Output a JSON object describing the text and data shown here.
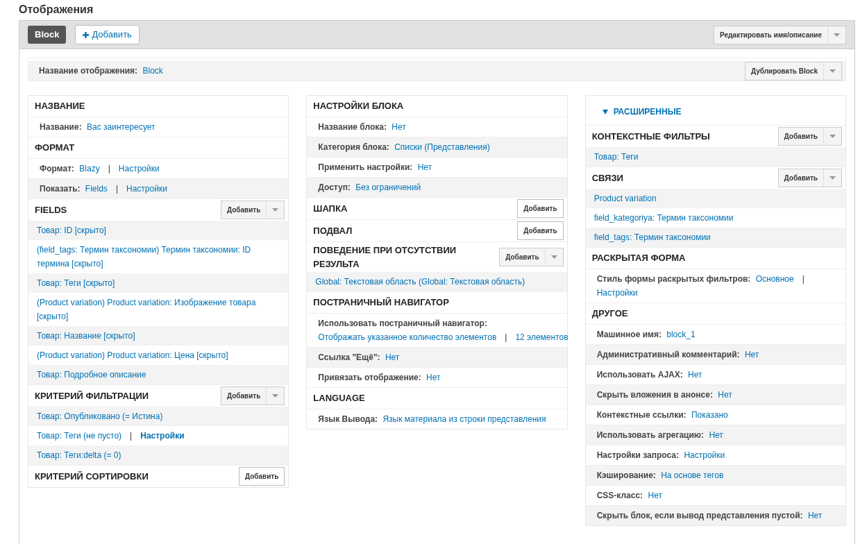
{
  "page_title": "Отображения",
  "displays": [
    {
      "label": "Block",
      "selected": true
    }
  ],
  "add_display": {
    "label": "Добавить"
  },
  "edit_button": {
    "label": "Редактировать имя/описание"
  },
  "display_name": {
    "label": "Название отображения:",
    "value": "Block"
  },
  "duplicate_button": {
    "label": "Дублировать Block"
  },
  "columns": [
    [
      {
        "title": "НАЗВАНИЕ",
        "rows": [
          {
            "kind": "setting",
            "label": "Название:",
            "parts": [
              {
                "kind": "link",
                "text": "Вас заинтересует"
              }
            ]
          }
        ]
      },
      {
        "title": "ФОРМАТ",
        "rows": [
          {
            "kind": "setting",
            "label": "Формат:",
            "parts": [
              {
                "kind": "link",
                "text": "Blazy"
              },
              {
                "kind": "separator",
                "text": "|"
              },
              {
                "kind": "link",
                "text": "Настройки"
              }
            ]
          },
          {
            "kind": "setting",
            "label": "Показать:",
            "parts": [
              {
                "kind": "link",
                "text": "Fields"
              },
              {
                "kind": "separator",
                "text": "|"
              },
              {
                "kind": "link",
                "text": "Настройки"
              }
            ]
          }
        ]
      },
      {
        "title": "FIELDS",
        "button": {
          "kind": "split",
          "label": "Добавить"
        },
        "rows": [
          {
            "kind": "item",
            "parts": [
              {
                "kind": "link",
                "text": "Товар: ID [скрыто]"
              }
            ]
          },
          {
            "kind": "item",
            "parts": [
              {
                "kind": "link",
                "text": "(field_tags: Термин таксономии) Термин таксономии: ID термина [скрыто]"
              }
            ]
          },
          {
            "kind": "item",
            "parts": [
              {
                "kind": "link",
                "text": "Товар: Теги [скрыто]"
              }
            ]
          },
          {
            "kind": "item",
            "parts": [
              {
                "kind": "link",
                "text": "(Product variation) Product variation: Изображение товара [скрыто]"
              }
            ]
          },
          {
            "kind": "item",
            "parts": [
              {
                "kind": "link",
                "text": "Товар: Название [скрыто]"
              }
            ]
          },
          {
            "kind": "item",
            "parts": [
              {
                "kind": "link",
                "text": "(Product variation) Product variation: Цена [скрыто]"
              }
            ]
          },
          {
            "kind": "item",
            "parts": [
              {
                "kind": "link",
                "text": "Товар: Подробное описание"
              }
            ]
          }
        ]
      },
      {
        "title": "КРИТЕРИЙ ФИЛЬТРАЦИИ",
        "button": {
          "kind": "split",
          "label": "Добавить"
        },
        "rows": [
          {
            "kind": "item",
            "parts": [
              {
                "kind": "link",
                "text": "Товар: Опубликовано (= Истина)"
              }
            ]
          },
          {
            "kind": "item",
            "parts": [
              {
                "kind": "link",
                "text": "Товар: Теги (не пусто)"
              },
              {
                "kind": "separator",
                "text": "|"
              },
              {
                "kind": "strong-link",
                "text": "Настройки"
              }
            ]
          },
          {
            "kind": "item",
            "parts": [
              {
                "kind": "link",
                "text": "Товар: Теги:delta (= 0)"
              }
            ]
          }
        ]
      },
      {
        "title": "КРИТЕРИЙ СОРТИРОВКИ",
        "button": {
          "kind": "plain",
          "label": "Добавить"
        }
      }
    ],
    [
      {
        "title": "НАСТРОЙКИ БЛОКА",
        "rows": [
          {
            "kind": "setting",
            "label": "Название блока:",
            "parts": [
              {
                "kind": "link",
                "text": "Нет"
              }
            ]
          },
          {
            "kind": "setting",
            "label": "Категория блока:",
            "parts": [
              {
                "kind": "link",
                "text": "Списки (Представления)"
              }
            ]
          },
          {
            "kind": "setting",
            "label": "Применить настройки:",
            "parts": [
              {
                "kind": "link",
                "text": "Нет"
              }
            ]
          },
          {
            "kind": "setting",
            "label": "Доступ:",
            "parts": [
              {
                "kind": "link",
                "text": "Без ограничений"
              }
            ]
          }
        ]
      },
      {
        "title": "ШАПКА",
        "button": {
          "kind": "plain",
          "label": "Добавить"
        }
      },
      {
        "title": "ПОДВАЛ",
        "button": {
          "kind": "plain",
          "label": "Добавить"
        }
      },
      {
        "title": "ПОВЕДЕНИЕ ПРИ ОТСУТСТВИИ РЕЗУЛЬТА",
        "button": {
          "kind": "split",
          "label": "Добавить"
        },
        "rows": [
          {
            "kind": "item",
            "parts": [
              {
                "kind": "link",
                "text": "Global: Текстовая область (Global: Текстовая область)"
              }
            ]
          }
        ]
      },
      {
        "title": "ПОСТРАНИЧНЫЙ НАВИГАТОР",
        "rows": [
          {
            "kind": "setting",
            "label": "Использовать постраничный навигатор:",
            "parts": [
              {
                "kind": "link",
                "text": "Отображать указанное количество элементов"
              },
              {
                "kind": "separator",
                "text": "|"
              },
              {
                "kind": "link",
                "text": "12 элементов"
              }
            ]
          },
          {
            "kind": "setting",
            "label": "Ссылка \"Ещё\":",
            "parts": [
              {
                "kind": "link",
                "text": "Нет"
              }
            ]
          },
          {
            "kind": "setting",
            "label": "Привязать отображение:",
            "parts": [
              {
                "kind": "link",
                "text": "Нет"
              }
            ]
          }
        ]
      },
      {
        "title": "LANGUAGE",
        "rows": [
          {
            "kind": "setting",
            "label": "Язык Вывода:",
            "parts": [
              {
                "kind": "link",
                "text": "Язык материала из строки представления"
              }
            ]
          }
        ]
      }
    ],
    [
      {
        "title": "КОНТЕКСТНЫЕ ФИЛЬТРЫ",
        "button": {
          "kind": "split",
          "label": "Добавить"
        },
        "rows": [
          {
            "kind": "item",
            "parts": [
              {
                "kind": "link",
                "text": "Товар: Теги"
              }
            ]
          }
        ]
      },
      {
        "title": "СВЯЗИ",
        "button": {
          "kind": "split",
          "label": "Добавить"
        },
        "rows": [
          {
            "kind": "item",
            "parts": [
              {
                "kind": "link",
                "text": "Product variation"
              }
            ]
          },
          {
            "kind": "item",
            "parts": [
              {
                "kind": "link",
                "text": "field_kategoriya: Термин таксономии"
              }
            ]
          },
          {
            "kind": "item",
            "parts": [
              {
                "kind": "link",
                "text": "field_tags: Термин таксономии"
              }
            ]
          }
        ]
      },
      {
        "title": "РАСКРЫТАЯ ФОРМА",
        "rows": [
          {
            "kind": "setting",
            "label": "Стиль формы раскрытых фильтров:",
            "parts": [
              {
                "kind": "link",
                "text": "Основное"
              },
              {
                "kind": "separator",
                "text": "|"
              },
              {
                "kind": "link",
                "text": "Настройки"
              }
            ]
          }
        ]
      },
      {
        "title": "ДРУГОЕ",
        "rows": [
          {
            "kind": "setting",
            "label": "Машинное имя:",
            "parts": [
              {
                "kind": "link",
                "text": "block_1"
              }
            ]
          },
          {
            "kind": "setting",
            "label": "Административный комментарий:",
            "parts": [
              {
                "kind": "link",
                "text": "Нет"
              }
            ]
          },
          {
            "kind": "setting",
            "label": "Использовать AJAX:",
            "parts": [
              {
                "kind": "link",
                "text": "Нет"
              }
            ]
          },
          {
            "kind": "setting",
            "label": "Скрыть вложения в анонсе:",
            "parts": [
              {
                "kind": "link",
                "text": "Нет"
              }
            ]
          },
          {
            "kind": "setting",
            "label": "Контекстные ссылки:",
            "parts": [
              {
                "kind": "link",
                "text": "Показано"
              }
            ]
          },
          {
            "kind": "setting",
            "label": "Использовать агрегацию:",
            "parts": [
              {
                "kind": "link",
                "text": "Нет"
              }
            ]
          },
          {
            "kind": "setting",
            "label": "Настройки запроса:",
            "parts": [
              {
                "kind": "link",
                "text": "Настройки"
              }
            ]
          },
          {
            "kind": "setting",
            "label": "Кэширование:",
            "parts": [
              {
                "kind": "link",
                "text": "На основе тегов"
              }
            ]
          },
          {
            "kind": "setting",
            "label": "CSS-класс:",
            "parts": [
              {
                "kind": "link",
                "text": "Нет"
              }
            ]
          },
          {
            "kind": "setting",
            "label": "Скрыть блок, если вывод представления пустой:",
            "parts": [
              {
                "kind": "link",
                "text": "Нет"
              }
            ]
          }
        ]
      }
    ]
  ],
  "advanced": {
    "label": "РАСШИРЕННЫЕ",
    "expanded": true
  }
}
